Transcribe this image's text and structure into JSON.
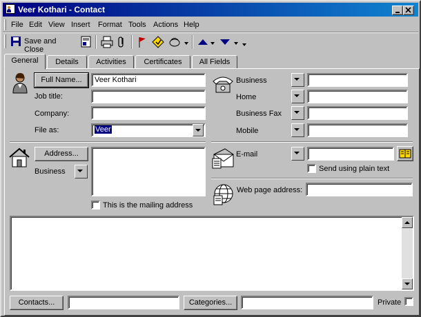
{
  "window": {
    "title": "Veer Kothari - Contact",
    "colors": {
      "titlebar_start": "#000080",
      "titlebar_end": "#1084d0",
      "face": "#c0c0c0",
      "selection": "#000080"
    }
  },
  "menu": {
    "items": [
      {
        "label": "File"
      },
      {
        "label": "Edit"
      },
      {
        "label": "View"
      },
      {
        "label": "Insert"
      },
      {
        "label": "Format"
      },
      {
        "label": "Tools"
      },
      {
        "label": "Actions"
      },
      {
        "label": "Help"
      }
    ]
  },
  "toolbar": {
    "save_close_label": "Save and Close"
  },
  "tabs": [
    {
      "label": "General",
      "active": true
    },
    {
      "label": "Details"
    },
    {
      "label": "Activities"
    },
    {
      "label": "Certificates"
    },
    {
      "label": "All Fields"
    }
  ],
  "general": {
    "full_name_button": "Full Name...",
    "full_name_value": "Veer Kothari",
    "job_title_label": "Job title:",
    "job_title_value": "",
    "company_label": "Company:",
    "company_value": "",
    "file_as_label": "File as:",
    "file_as_value": "Veer",
    "address_button": "Address...",
    "address_type": "Business",
    "address_value": "",
    "mailing_address_label": "This is the mailing address",
    "mailing_address_checked": false,
    "phones": [
      {
        "label": "Business",
        "value": ""
      },
      {
        "label": "Home",
        "value": ""
      },
      {
        "label": "Business Fax",
        "value": ""
      },
      {
        "label": "Mobile",
        "value": ""
      }
    ],
    "email_label": "E-mail",
    "email_value": "",
    "plain_text_label": "Send using plain text",
    "plain_text_checked": false,
    "web_label": "Web page address:",
    "web_value": "",
    "notes_value": ""
  },
  "footer": {
    "contacts_button": "Contacts...",
    "contacts_value": "",
    "categories_button": "Categories...",
    "categories_value": "",
    "private_label": "Private",
    "private_checked": false
  },
  "icons": [
    "contact-card-icon",
    "minimize-icon",
    "maximize-icon",
    "close-icon",
    "save-icon",
    "print-icon",
    "attach-icon",
    "flag-icon",
    "followup-icon",
    "newmsg-icon",
    "up-arrow-icon",
    "down-arrow-icon",
    "person-icon",
    "house-icon",
    "phone-icon",
    "envelope-icon",
    "globe-icon",
    "addressbook-icon"
  ]
}
